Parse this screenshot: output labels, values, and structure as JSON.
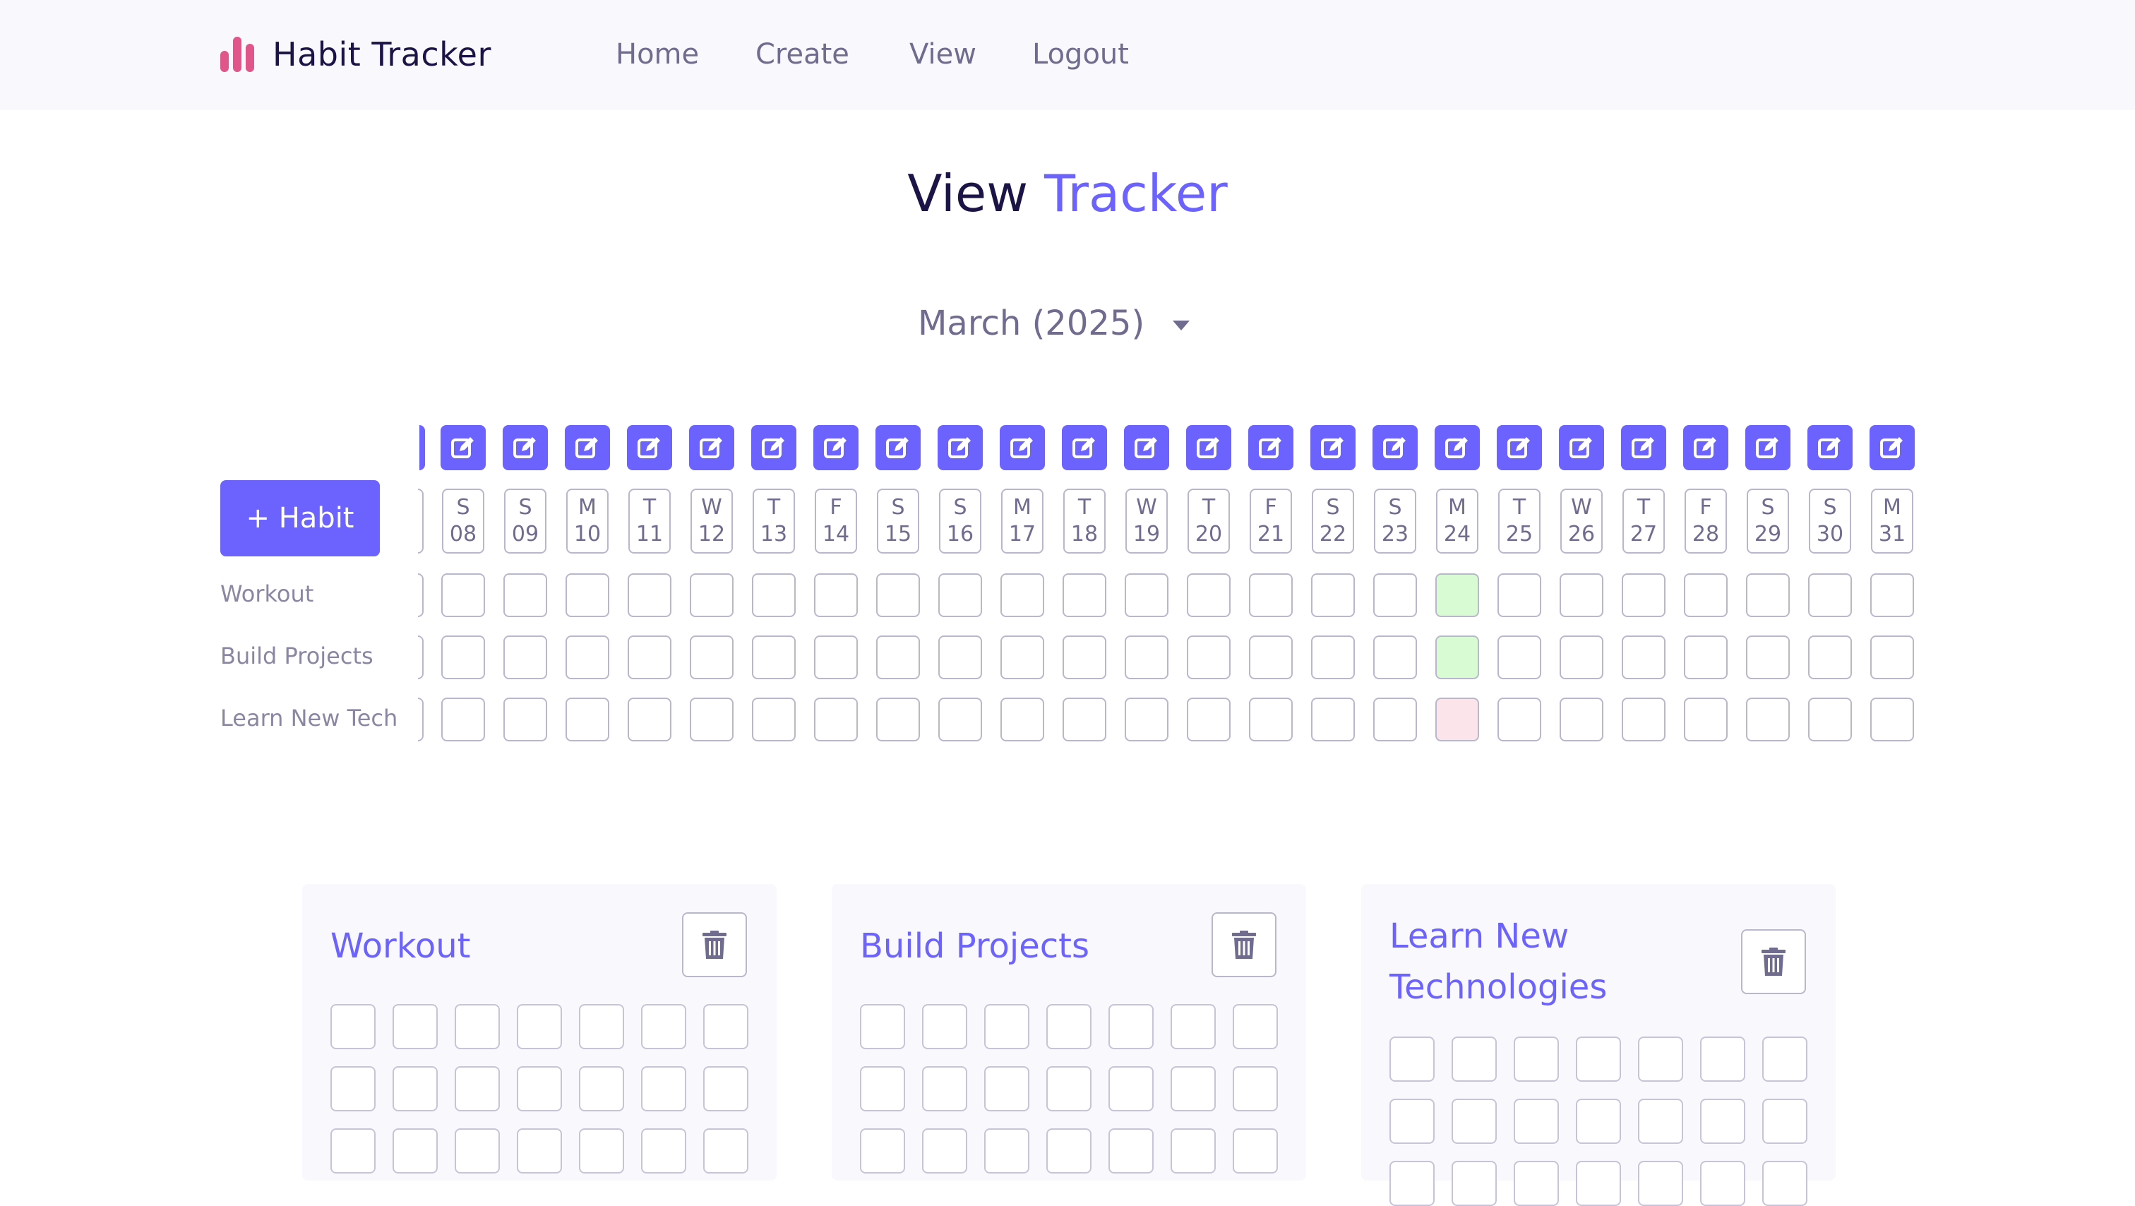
{
  "nav": {
    "brand": "Habit Tracker",
    "links": [
      "Home",
      "Create",
      "View",
      "Logout"
    ]
  },
  "title": {
    "part1": "View",
    "part2": "Tracker"
  },
  "month_selector": {
    "selected": "March (2025)"
  },
  "add_button": "+ Habit",
  "days": [
    {
      "dow": "S",
      "date": "08"
    },
    {
      "dow": "S",
      "date": "09"
    },
    {
      "dow": "M",
      "date": "10"
    },
    {
      "dow": "T",
      "date": "11"
    },
    {
      "dow": "W",
      "date": "12"
    },
    {
      "dow": "T",
      "date": "13"
    },
    {
      "dow": "F",
      "date": "14"
    },
    {
      "dow": "S",
      "date": "15"
    },
    {
      "dow": "S",
      "date": "16"
    },
    {
      "dow": "M",
      "date": "17"
    },
    {
      "dow": "T",
      "date": "18"
    },
    {
      "dow": "W",
      "date": "19"
    },
    {
      "dow": "T",
      "date": "20"
    },
    {
      "dow": "F",
      "date": "21"
    },
    {
      "dow": "S",
      "date": "22"
    },
    {
      "dow": "S",
      "date": "23"
    },
    {
      "dow": "M",
      "date": "24"
    },
    {
      "dow": "T",
      "date": "25"
    },
    {
      "dow": "W",
      "date": "26"
    },
    {
      "dow": "T",
      "date": "27"
    },
    {
      "dow": "F",
      "date": "28"
    },
    {
      "dow": "S",
      "date": "29"
    },
    {
      "dow": "S",
      "date": "30"
    },
    {
      "dow": "M",
      "date": "31"
    }
  ],
  "habits": [
    {
      "name": "Workout",
      "status": [
        "",
        "",
        "",
        "",
        "",
        "",
        "",
        "",
        "",
        "",
        "",
        "",
        "",
        "",
        "",
        "",
        "done",
        "",
        "",
        "",
        "",
        "",
        "",
        ""
      ]
    },
    {
      "name": "Build Projects",
      "status": [
        "",
        "",
        "",
        "",
        "",
        "",
        "",
        "",
        "",
        "",
        "",
        "",
        "",
        "",
        "",
        "",
        "done",
        "",
        "",
        "",
        "",
        "",
        "",
        ""
      ]
    },
    {
      "name": "Learn New Tech",
      "status": [
        "",
        "",
        "",
        "",
        "",
        "",
        "",
        "",
        "",
        "",
        "",
        "",
        "",
        "",
        "",
        "",
        "missed",
        "",
        "",
        "",
        "",
        "",
        "",
        ""
      ]
    }
  ],
  "cards": [
    {
      "title": "Workout"
    },
    {
      "title": "Build Projects"
    },
    {
      "title": "Learn New Technologies"
    }
  ],
  "colors": {
    "accent": "#6c63ff",
    "done": "#d9fbd3",
    "missed": "#fbe5ea",
    "brand_logo": "#e0558a"
  }
}
